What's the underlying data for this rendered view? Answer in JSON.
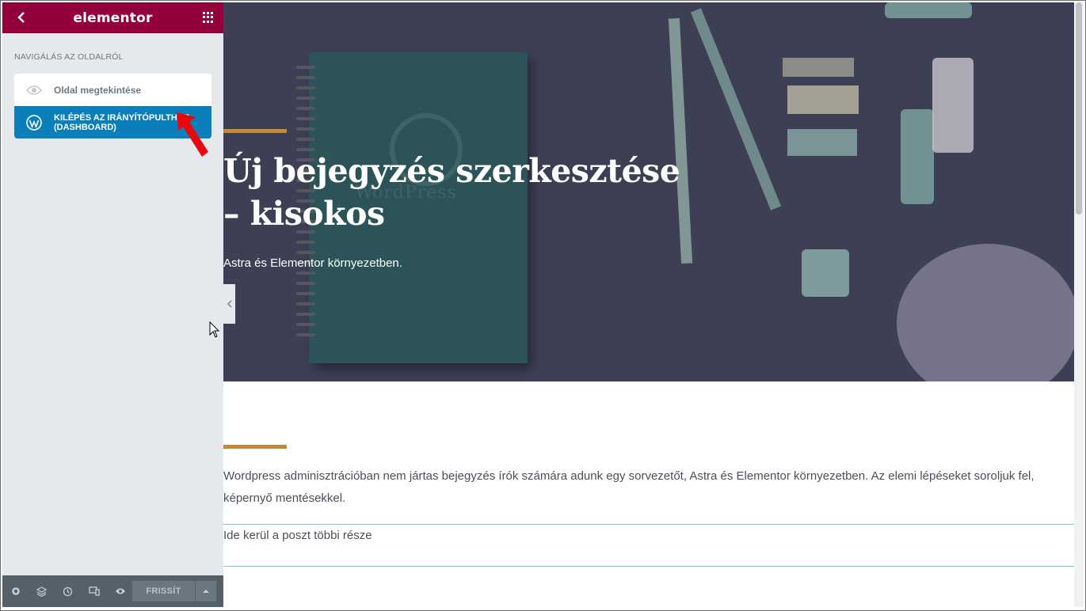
{
  "sidebar": {
    "logo": "elementor",
    "section_title": "NAVIGÁLÁS AZ OLDALRÓL",
    "items": [
      {
        "label": "Oldal megtekintése",
        "icon": "eye-icon"
      },
      {
        "label": "KILÉPÉS AZ IRÁNYÍTÓPULTHOZ (DASHBOARD)",
        "icon": "wordpress-icon"
      }
    ],
    "footer": {
      "icons": [
        "settings-icon",
        "layers-icon",
        "history-icon",
        "responsive-icon",
        "preview-eye-icon"
      ],
      "update_label": "FRISSÍT"
    }
  },
  "hero": {
    "title": "Új bejegyzés szerkesztése – kisokos",
    "subtitle": "Astra és Elementor környezetben.",
    "notebook_text": "WordPress"
  },
  "content": {
    "paragraph": "Wordpress adminisztrációban nem jártas bejegyzés írók számára adunk egy sorvezetőt, Astra és Elementor környezetben. Az elemi lépéseket soroljuk fel, képernyő mentésekkel.",
    "more_text": "Ide kerül a poszt többi része"
  },
  "colors": {
    "brand": "#93003c",
    "active_item": "#0b7fb9",
    "accent_bar": "#c38a3a",
    "divider": "#7dc6d4"
  }
}
